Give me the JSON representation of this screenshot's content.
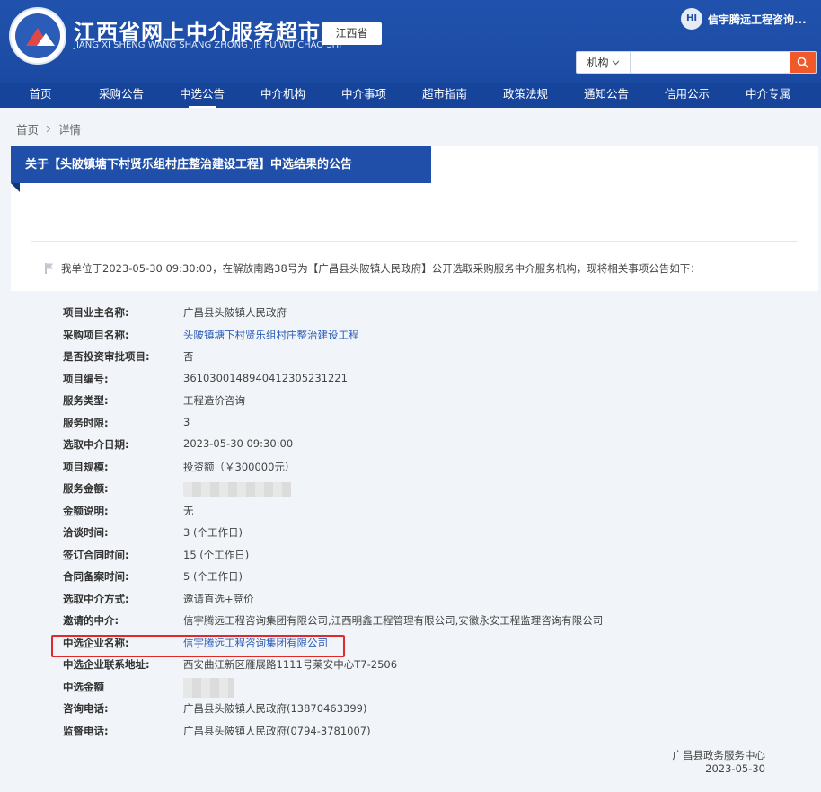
{
  "header": {
    "title": "江西省网上中介服务超市",
    "subtitle": "JIANG XI SHENG WANG SHANG ZHONG JIE FU WU CHAO SHI",
    "region": "江西省",
    "user": {
      "avatar_text": "HI",
      "name": "信宇腾远工程咨询..."
    },
    "search": {
      "select_label": "机构",
      "placeholder": ""
    }
  },
  "nav": [
    "首页",
    "采购公告",
    "中选公告",
    "中介机构",
    "中介事项",
    "超市指南",
    "政策法规",
    "通知公告",
    "信用公示",
    "中介专属"
  ],
  "breadcrumb": {
    "home": "首页",
    "current": "详情"
  },
  "notice": {
    "title": "关于【头陂镇塘下村贤乐组村庄整治建设工程】中选结果的公告",
    "intro": "我单位于2023-05-30 09:30:00，在解放南路38号为【广昌县头陂镇人民政府】公开选取采购服务中介服务机构，现将相关事项公告如下：",
    "fields": [
      {
        "label": "项目业主名称:",
        "value": "广昌县头陂镇人民政府"
      },
      {
        "label": "采购项目名称:",
        "value": "头陂镇塘下村贤乐组村庄整治建设工程"
      },
      {
        "label": "是否投资审批项目:",
        "value": "否"
      },
      {
        "label": "项目编号:",
        "value": "361030014894041230523122​1"
      },
      {
        "label": "服务类型:",
        "value": "工程造价咨询"
      },
      {
        "label": "服务时限:",
        "value": "3"
      },
      {
        "label": "选取中介日期:",
        "value": "2023-05-30 09:30:00"
      },
      {
        "label": "项目规模:",
        "value": "投资额（￥300000元）"
      },
      {
        "label": "服务金额:",
        "value": ""
      },
      {
        "label": "金额说明:",
        "value": "无"
      },
      {
        "label": "洽谈时间:",
        "value": "3 (个工作日)"
      },
      {
        "label": "签订合同时间:",
        "value": "15 (个工作日)"
      },
      {
        "label": "合同备案时间:",
        "value": "5 (个工作日)"
      },
      {
        "label": "选取中介方式:",
        "value": "邀请直选+竞价"
      },
      {
        "label": "邀请的中介:",
        "value": "信宇腾远工程咨询集团有限公司,江西明鑫工程管理有限公司,安徽永安工程监理咨询有限公司"
      },
      {
        "label": "中选企业名称:",
        "value": "信宇腾远工程咨询集团有限公司"
      },
      {
        "label": "中选企业联系地址:",
        "value": "西安曲江新区雁展路1111号莱安中心T7-2506"
      },
      {
        "label": "中选金额",
        "value": ""
      },
      {
        "label": "咨询电话:",
        "value": "广昌县头陂镇人民政府(13870463399)"
      },
      {
        "label": "监督电话:",
        "value": "广昌县头陂镇人民政府(0794-3781007)"
      }
    ],
    "signature": {
      "org": "广昌县政务服务中心",
      "date": "2023-05-30"
    }
  },
  "colors": {
    "primary": "#1f4fa9",
    "nav": "#17449b",
    "search_button": "#f05a2b",
    "highlight": "#e02a2a"
  }
}
